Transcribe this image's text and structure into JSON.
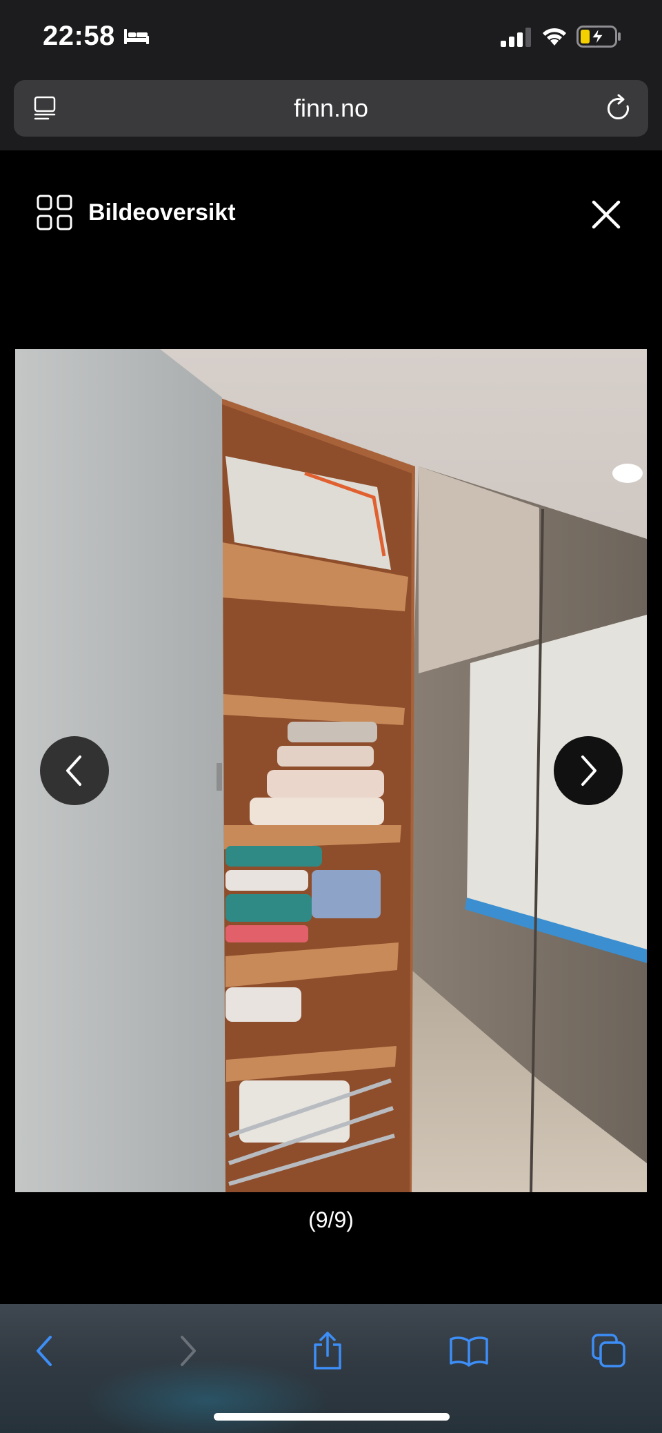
{
  "status_bar": {
    "time": "22:58",
    "icons": [
      "bed-icon",
      "signal-icon",
      "wifi-icon",
      "battery-charging-icon"
    ]
  },
  "browser": {
    "url": "finn.no",
    "icons": [
      "reader-icon",
      "reload-icon"
    ]
  },
  "gallery": {
    "overview_label": "Bildeoversikt",
    "counter": "(9/9)",
    "icons": [
      "grid-icon",
      "close-icon",
      "chevron-left-icon",
      "chevron-right-icon"
    ],
    "photo_description_icon": "photo-wardrobe"
  },
  "toolbar": {
    "icons": [
      "back-icon",
      "forward-icon",
      "share-icon",
      "bookmarks-icon",
      "tabs-icon"
    ],
    "accent_color": "#3d8ef7",
    "disabled_color": "#6b7178"
  }
}
